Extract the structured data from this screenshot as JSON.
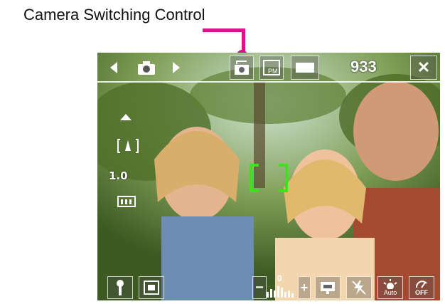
{
  "annotation": {
    "caption": "Camera Switching Control",
    "callout_color": "#d6168f"
  },
  "toolbar": {
    "prev_icon": "chevron-left-icon",
    "mode_icon": "camera-icon",
    "next_icon": "chevron-right-icon",
    "camera_switch_icon": "camera-switch-icon",
    "timestamp_icon": "timestamp-icon",
    "resolution_icon": "resolution-icon",
    "shots_remaining": "933",
    "close_label": "✕"
  },
  "left_controls": {
    "zoom_in_icon": "zoom-up-icon",
    "zoom_mode_icon": "zoom-mode-icon",
    "zoom_level": "1.0",
    "quality_icon": "memory-icon"
  },
  "viewfinder": {
    "focus_color": "#3ee21a"
  },
  "bottom_bar": {
    "tools_icon": "tools-icon",
    "scene_icon": "scene-icon",
    "brightness_minus": "−",
    "brightness_value": "0",
    "brightness_plus": "+",
    "display_icon": "display-icon",
    "flash_icon": "flash-off-icon",
    "white_balance_label": "Auto",
    "self_timer_label": "OFF"
  }
}
